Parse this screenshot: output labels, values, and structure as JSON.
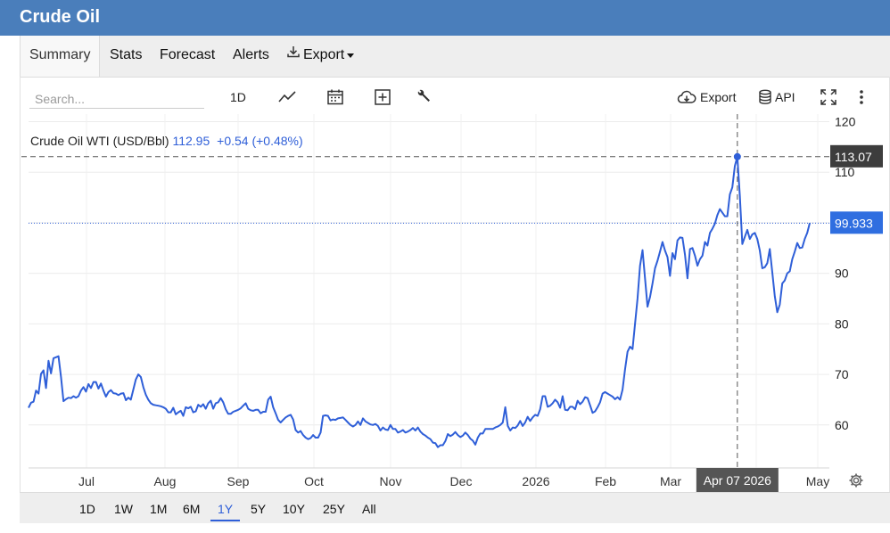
{
  "window": {
    "title": "Crude Oil"
  },
  "tabs": [
    {
      "label": "Summary",
      "active": true
    },
    {
      "label": "Stats"
    },
    {
      "label": "Forecast"
    },
    {
      "label": "Alerts"
    },
    {
      "label": "Export",
      "icon": "download-icon",
      "dropdown": true
    }
  ],
  "toolbar": {
    "search_placeholder": "Search...",
    "interval": "1D",
    "export_label": "Export",
    "api_label": "API",
    "icons": [
      "line-chart-icon",
      "calendar-icon",
      "add-box-icon",
      "wrench-icon",
      "cloud-download-icon",
      "database-icon",
      "fullscreen-icon",
      "more-vertical-icon"
    ]
  },
  "legend": {
    "name": "Crude Oil WTI (USD/Bbl)",
    "price": "112.95",
    "change": "+0.54 (+0.48%)"
  },
  "crosshair": {
    "price_label": "113.07",
    "date_label": "Apr 07 2026"
  },
  "last_price_label": "99.933",
  "range_buttons": [
    "1D",
    "1W",
    "1M",
    "6M",
    "1Y",
    "5Y",
    "10Y",
    "25Y",
    "All"
  ],
  "active_range": "1Y",
  "colors": {
    "header": "#4a7ebb",
    "line": "#2f5fd8",
    "accent": "#2f5fd8",
    "crosshair_label": "#3d3d3d"
  },
  "chart_data": {
    "type": "line",
    "grid": true,
    "ylim": [
      51.5,
      121.5
    ],
    "y_ticks": [
      "60",
      "70",
      "80",
      "90",
      "100",
      "110",
      "120"
    ],
    "x_ticks": [
      "Jul",
      "Aug",
      "Sep",
      "Oct",
      "Nov",
      "Dec",
      "2026",
      "Feb",
      "Mar",
      "Apr",
      "May"
    ],
    "series": [
      {
        "values": [
          63.4,
          64.4,
          64.6,
          66.8,
          66.2,
          70.1,
          70.8,
          67.3,
          72.7,
          70.2,
          73.2,
          73.4,
          73.6,
          69.5,
          64.7,
          65.1,
          65.4,
          65.3,
          65.7,
          65.4,
          65.7,
          66.8,
          67.5,
          66.6,
          68.1,
          67.3,
          68.5,
          68.5,
          67.2,
          68.2,
          66.8,
          65.6,
          66.5,
          66.9,
          66.3,
          66.2,
          65.9,
          66.2,
          66.3,
          64.9,
          65.4,
          65.0,
          67.0,
          69.0,
          70.0,
          69.5,
          67.5,
          66.0,
          65.0,
          64.3,
          64.0,
          63.9,
          63.8,
          63.7,
          63.5,
          63.2,
          62.5,
          62.5,
          63.4,
          62.1,
          62.5,
          62.8,
          61.8,
          63.5,
          63.3,
          63.6,
          62.5,
          62.7,
          64.0,
          63.6,
          64.1,
          63.2,
          64.3,
          64.8,
          63.2,
          64.3,
          64.5,
          65.3,
          64.5,
          63.1,
          62.2,
          62.2,
          62.6,
          62.8,
          63.0,
          63.3,
          63.8,
          64.3,
          63.2,
          62.9,
          62.8,
          63.0,
          63.0,
          62.3,
          62.6,
          62.6,
          65.0,
          65.6,
          63.5,
          62.3,
          61.0,
          60.5,
          61.0,
          61.5,
          61.8,
          62.0,
          61.1,
          59.0,
          58.5,
          58.8,
          58.0,
          57.5,
          57.2,
          57.4,
          58.0,
          57.5,
          57.5,
          58.5,
          61.8,
          61.9,
          61.8,
          60.9,
          61.1,
          61.0,
          61.3,
          61.4,
          61.5,
          61.0,
          60.5,
          60.0,
          59.7,
          60.0,
          60.7,
          60.0,
          61.3,
          60.7,
          60.4,
          60.1,
          60.0,
          60.2,
          59.8,
          58.9,
          59.5,
          59.1,
          59.0,
          60.0,
          59.2,
          59.2,
          58.5,
          58.7,
          59.0,
          58.5,
          58.7,
          59.0,
          59.4,
          58.9,
          59.5,
          58.7,
          58.2,
          57.9,
          57.5,
          57.2,
          56.5,
          56.4,
          55.6,
          56.0,
          56.0,
          56.8,
          58.2,
          57.8,
          58.1,
          58.6,
          58.0,
          57.6,
          57.9,
          58.5,
          58.0,
          57.3,
          56.9,
          56.1,
          57.5,
          58.3,
          58.3,
          59.2,
          59.2,
          59.2,
          59.2,
          59.5,
          59.7,
          60.0,
          60.5,
          63.5,
          59.8,
          58.9,
          59.5,
          59.4,
          59.9,
          60.8,
          59.8,
          60.5,
          61.6,
          60.8,
          61.5,
          62.0,
          61.8,
          63.1,
          65.7,
          65.7,
          63.6,
          63.8,
          64.3,
          65.0,
          64.5,
          63.4,
          65.7,
          63.0,
          62.9,
          63.6,
          63.6,
          63.1,
          64.8,
          64.1,
          64.6,
          65.5,
          65.3,
          63.9,
          62.4,
          62.7,
          63.5,
          64.5,
          66.2,
          66.5,
          66.2,
          65.9,
          65.6,
          65.1,
          65.5,
          65.0,
          67.0,
          71.0,
          74.5,
          75.5,
          75.0,
          80.0,
          85.0,
          91.5,
          94.6,
          89.0,
          83.4,
          85.3,
          88.0,
          91.0,
          92.5,
          94.3,
          96.2,
          94.5,
          93.2,
          89.5,
          94.0,
          92.8,
          96.5,
          97.1,
          97.0,
          93.7,
          89.0,
          94.8,
          95.0,
          93.5,
          91.5,
          92.8,
          93.5,
          96.2,
          95.5,
          98.0,
          98.8,
          99.8,
          101.5,
          102.7,
          102.0,
          101.3,
          101.3,
          105.6,
          107.0,
          111.2,
          113.07,
          105.4,
          95.8,
          97.2,
          98.6,
          96.8,
          97.7,
          98.0,
          96.8,
          94.5,
          91.0,
          91.2,
          92.0,
          94.8,
          90.2,
          85.5,
          82.3,
          83.8,
          88.0,
          88.6,
          90.0,
          90.4,
          92.8,
          94.3,
          96.0,
          95.0,
          95.1,
          96.8,
          98.0,
          99.933
        ]
      }
    ],
    "last_value": 99.933
  }
}
